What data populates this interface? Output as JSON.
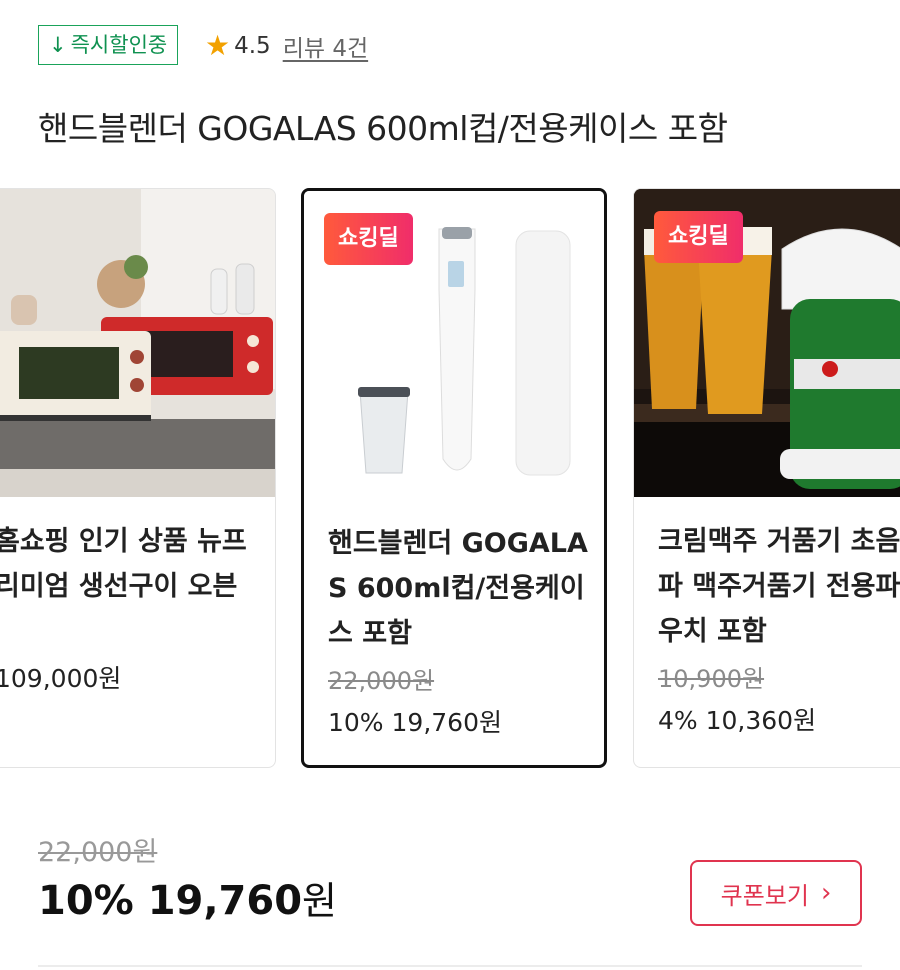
{
  "badge": {
    "icon": "down-arrow-icon",
    "arrow": "↓",
    "label": "즉시할인중"
  },
  "rating": {
    "icon": "star-icon",
    "star": "★",
    "score": "4.5",
    "reviews": "리뷰 4건"
  },
  "title": "핸드블렌더 GOGALAS 600ml컵/전용케이스 포함",
  "cards": [
    {
      "deal": "",
      "name": "홈쇼핑 인기 상품 뉴프리미엄 생선구이 오븐",
      "orig": "",
      "price": "109,000원"
    },
    {
      "deal": "쇼킹딜",
      "name": "핸드블렌더 GOGALAS 600ml컵/전용케이스 포함",
      "orig": "22,000원",
      "price": "10% 19,760원"
    },
    {
      "deal": "쇼킹딜",
      "name": "크림맥주 거품기 초음파 맥주거품기 전용파우치 포함",
      "orig": "10,900원",
      "price": "4% 10,360원"
    }
  ],
  "summary": {
    "orig": "22,000원",
    "discount": "10%",
    "price": "19,760",
    "won": "원"
  },
  "coupon": {
    "label": "쿠폰보기",
    "chevron": "›"
  },
  "colors": {
    "accent_green": "#1aa35a",
    "coupon_red": "#e0344f",
    "deal_gradient_start": "#ff5a3c",
    "deal_gradient_end": "#f02d6a"
  }
}
